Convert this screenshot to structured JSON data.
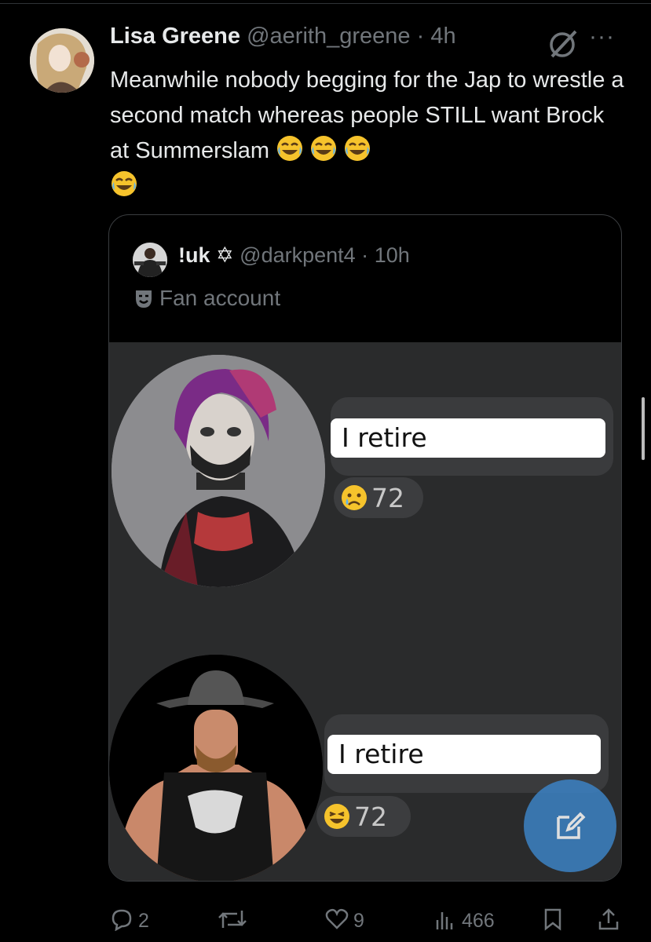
{
  "tweet": {
    "name": "Lisa Greene",
    "handle": "@aerith_greene",
    "separator": "·",
    "time": "4h",
    "more": "···",
    "text": "Meanwhile nobody begging for the Jap to wrestle a second match whereas people STILL want Brock at Summerslam",
    "emojis": [
      "joy-emoji",
      "joy-emoji",
      "joy-emoji",
      "joy-emoji"
    ]
  },
  "quote": {
    "name": "!uk",
    "name_symbol": "✡",
    "handle": "@darkpent4",
    "separator": "·",
    "time": "10h",
    "label": "Fan account",
    "meme": {
      "top": {
        "bubble_text": "I retire",
        "reaction_icon": "sad-tear-emoji",
        "reaction_count": "72"
      },
      "bottom": {
        "bubble_text": "I retire",
        "reaction_icon": "laughing-emoji",
        "reaction_count": "72"
      }
    }
  },
  "actions": {
    "replies": "2",
    "retweets": "",
    "likes": "9",
    "views": "466"
  },
  "colors": {
    "background": "#000000",
    "muted": "#71767b",
    "text": "#e7e9ea",
    "fab": "#3c82c4"
  }
}
